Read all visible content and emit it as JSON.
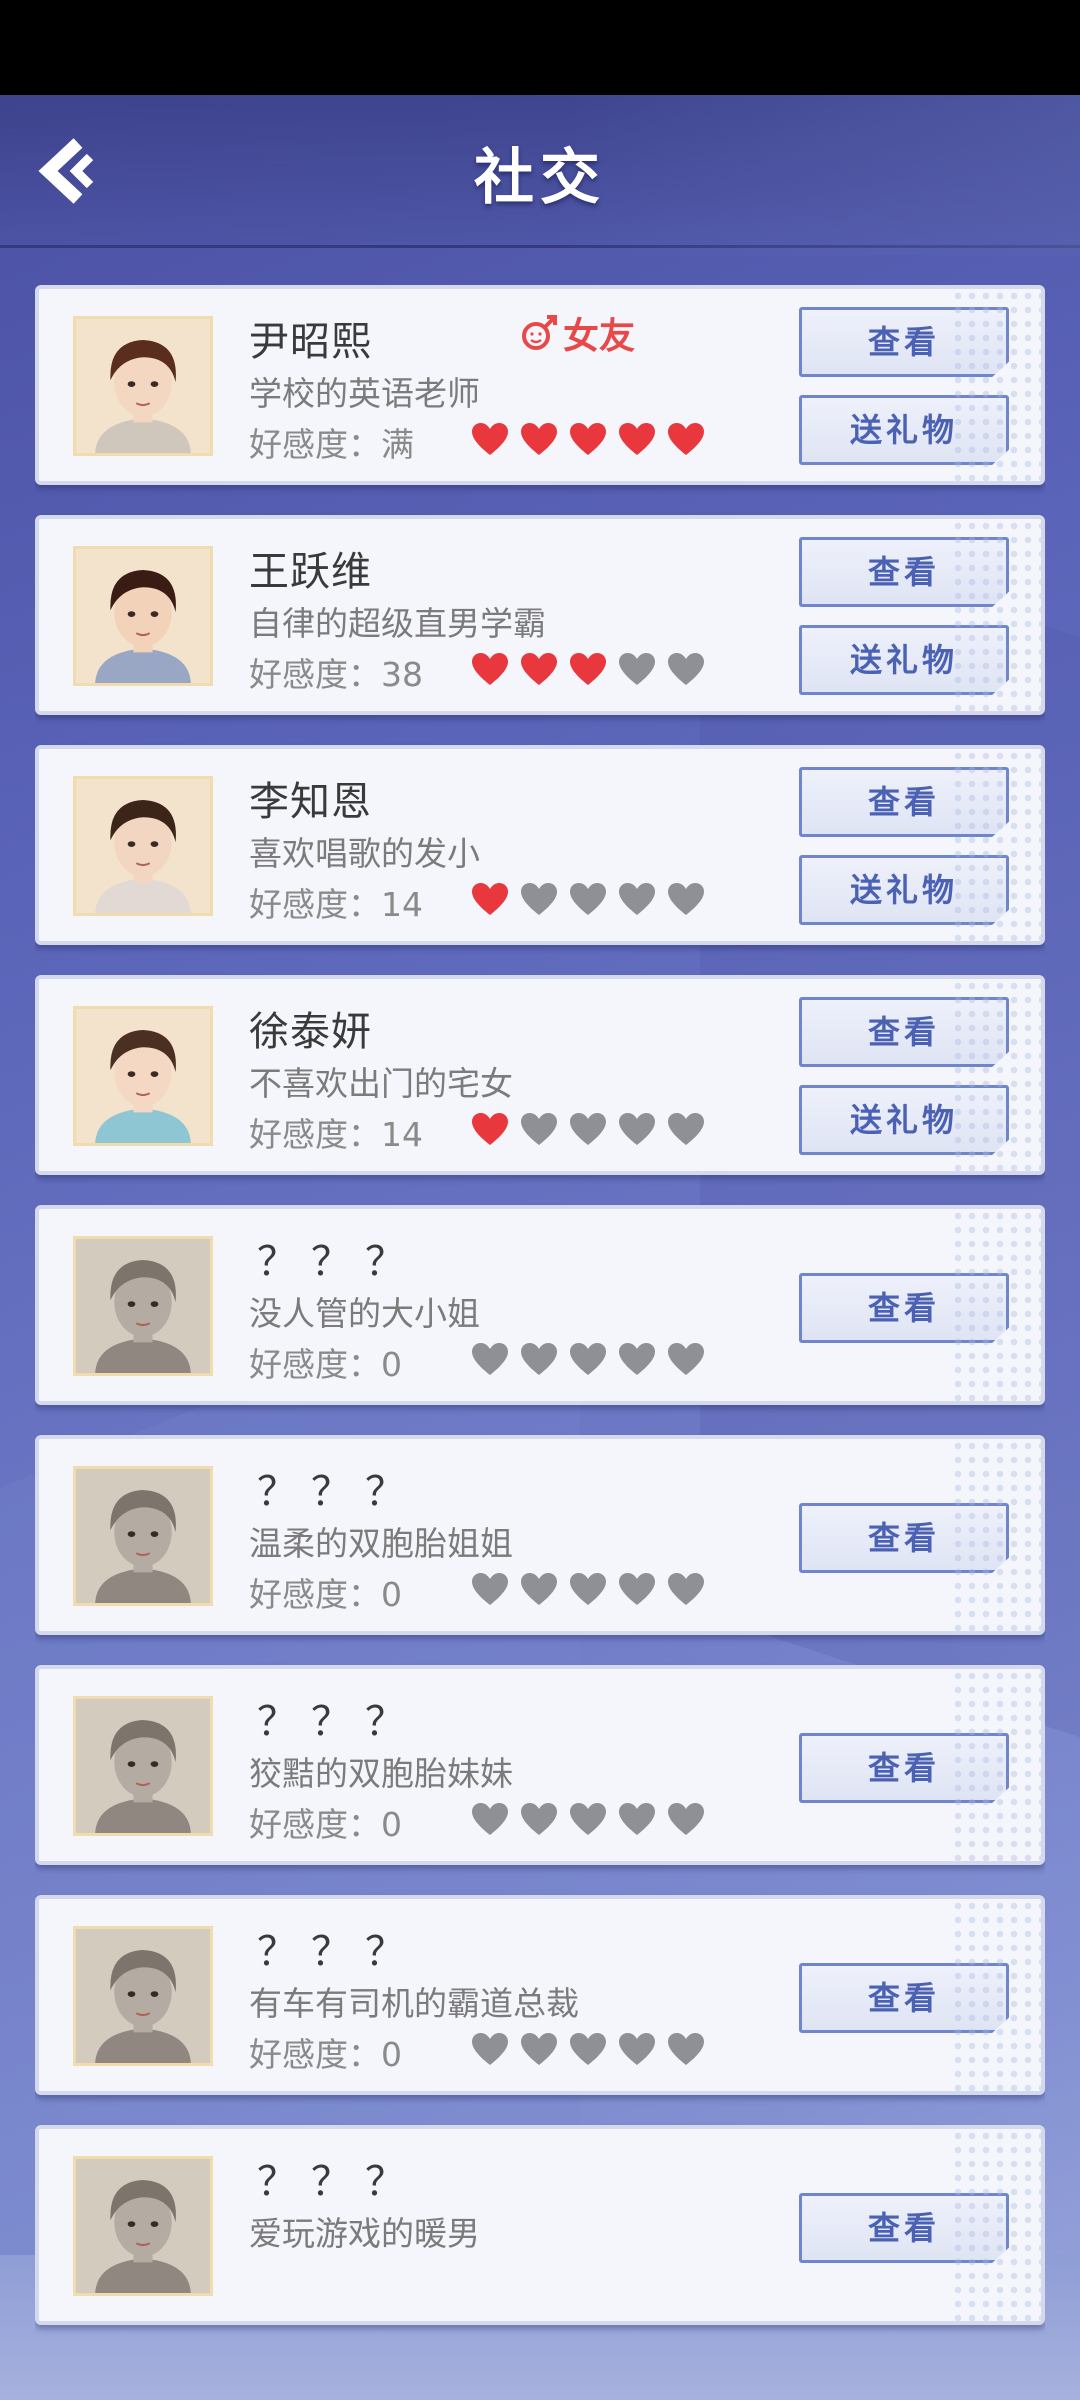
{
  "header": {
    "title": "社交"
  },
  "colors": {
    "heart_on": "#e8383d",
    "heart_off": "#8e9096",
    "accent": "#4b62b4"
  },
  "characters": [
    {
      "name": "尹昭熙",
      "desc": "学校的英语老师",
      "affinity_text": "好感度：满",
      "hearts": 5,
      "badge": "女友",
      "view": "查看",
      "gift": "送礼物",
      "locked": false
    },
    {
      "name": "王跃维",
      "desc": "自律的超级直男学霸",
      "affinity_text": "好感度：38",
      "hearts": 3,
      "view": "查看",
      "gift": "送礼物",
      "locked": false
    },
    {
      "name": "李知恩",
      "desc": "喜欢唱歌的发小",
      "affinity_text": "好感度：14",
      "hearts": 1,
      "view": "查看",
      "gift": "送礼物",
      "locked": false
    },
    {
      "name": "徐泰妍",
      "desc": "不喜欢出门的宅女",
      "affinity_text": "好感度：14",
      "hearts": 1,
      "view": "查看",
      "gift": "送礼物",
      "locked": false
    },
    {
      "name": "？？？",
      "desc": "没人管的大小姐",
      "affinity_text": "好感度：0",
      "hearts": 0,
      "view": "查看",
      "locked": true
    },
    {
      "name": "？？？",
      "desc": "温柔的双胞胎姐姐",
      "affinity_text": "好感度：0",
      "hearts": 0,
      "view": "查看",
      "locked": true
    },
    {
      "name": "？？？",
      "desc": "狡黠的双胞胎妹妹",
      "affinity_text": "好感度：0",
      "hearts": 0,
      "view": "查看",
      "locked": true
    },
    {
      "name": "？？？",
      "desc": "有车有司机的霸道总裁",
      "affinity_text": "好感度：0",
      "hearts": 0,
      "view": "查看",
      "locked": true
    },
    {
      "name": "？？？",
      "desc": "爱玩游戏的暖男",
      "affinity_text": "",
      "hearts": 0,
      "view": "查看",
      "locked": true
    }
  ]
}
